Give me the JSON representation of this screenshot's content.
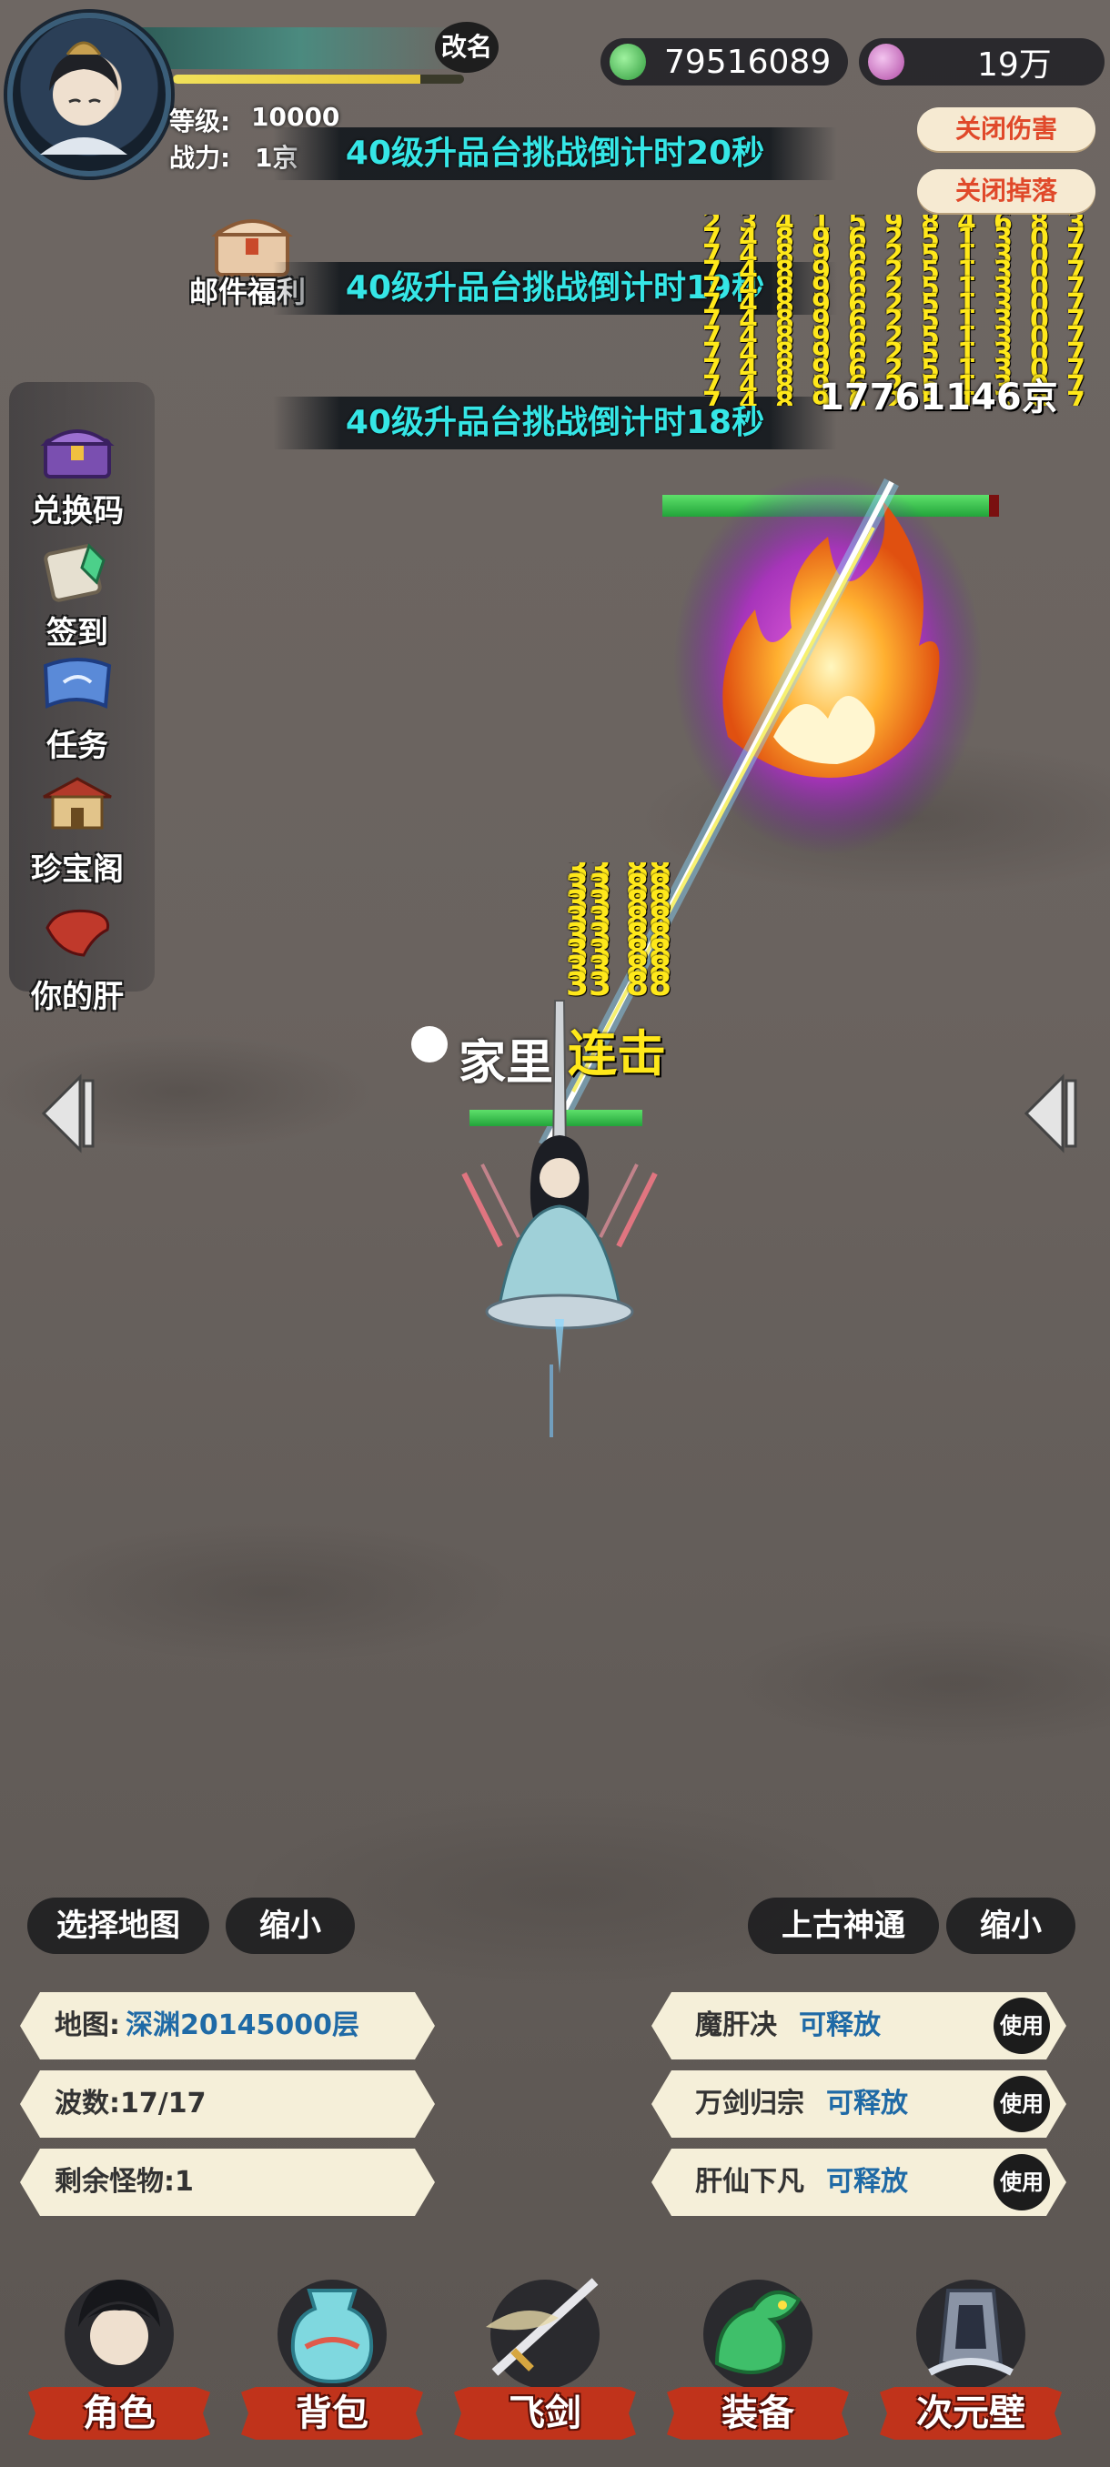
{
  "player": {
    "rename_label": "改名",
    "level_label": "等级:",
    "level_value": "10000",
    "power_label": "战力:",
    "power_value": "1京",
    "exp_progress": 0.85
  },
  "currency": {
    "gems": "79516089",
    "spirit": "19万"
  },
  "toggles": {
    "close_damage": "关闭伤害",
    "close_drops": "关闭掉落"
  },
  "banners": [
    "40级升品台挑战倒计时20秒",
    "40级升品台挑战倒计时19秒",
    "40级升品台挑战倒计时18秒"
  ],
  "mail_label": "邮件福利",
  "side_menu": [
    {
      "label": "兑换码",
      "icon": "chest-icon"
    },
    {
      "label": "签到",
      "icon": "scroll-icon"
    },
    {
      "label": "任务",
      "icon": "task-scroll-icon"
    },
    {
      "label": "珍宝阁",
      "icon": "pavilion-icon"
    },
    {
      "label": "你的肝",
      "icon": "liver-icon"
    }
  ],
  "battle": {
    "damage_number": "17761146京",
    "combo_label": "连击",
    "player_name": "家里",
    "enemy_hp": 0.97,
    "player_hp": 1.0
  },
  "controls": {
    "select_map": "选择地图",
    "shrink_left": "缩小",
    "ancient_power": "上古神通",
    "shrink_right": "缩小"
  },
  "status": {
    "map_label": "地图:",
    "map_value": "深渊20145000层",
    "wave_label": "波数:17/17",
    "monsters_label": "剩余怪物:1"
  },
  "skills": [
    {
      "name": "魔肝决",
      "state": "可释放",
      "button": "使用"
    },
    {
      "name": "万剑归宗",
      "state": "可释放",
      "button": "使用"
    },
    {
      "name": "肝仙下凡",
      "state": "可释放",
      "button": "使用"
    }
  ],
  "bottom_nav": [
    {
      "label": "角色",
      "icon": "character-icon"
    },
    {
      "label": "背包",
      "icon": "bag-icon"
    },
    {
      "label": "飞剑",
      "icon": "flying-sword-icon"
    },
    {
      "label": "装备",
      "icon": "dragon-equipment-icon"
    },
    {
      "label": "次元壁",
      "icon": "dimension-wall-icon"
    }
  ],
  "colors": {
    "banner_text": "#35e6e6",
    "damage_text": "#ffe81a",
    "nav_label_bg": "#c0331b",
    "toggle_text": "#e0492a",
    "skill_state": "#1f6aa6"
  }
}
